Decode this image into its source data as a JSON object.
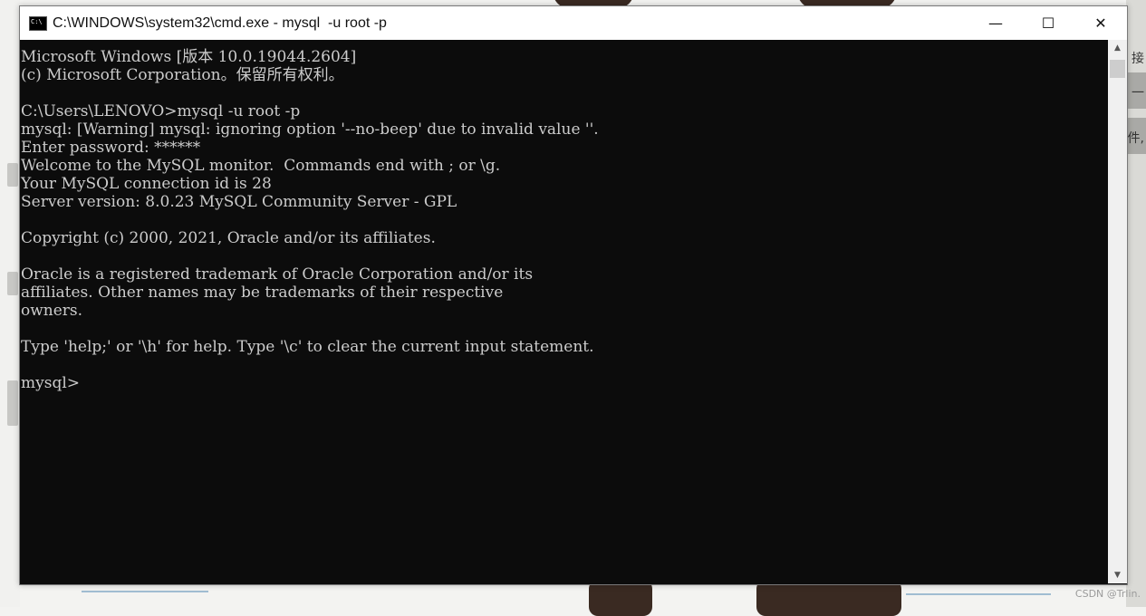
{
  "window": {
    "title": "C:\\WINDOWS\\system32\\cmd.exe - mysql  -u root -p",
    "controls": {
      "minimize": "—",
      "maximize": "☐",
      "close": "✕"
    }
  },
  "console": {
    "text": "Microsoft Windows [版本 10.0.19044.2604]\n(c) Microsoft Corporation。保留所有权利。\n\nC:\\Users\\LENOVO>mysql -u root -p\nmysql: [Warning] mysql: ignoring option '--no-beep' due to invalid value ''.\nEnter password: ******\nWelcome to the MySQL monitor.  Commands end with ; or \\g.\nYour MySQL connection id is 28\nServer version: 8.0.23 MySQL Community Server - GPL\n\nCopyright (c) 2000, 2021, Oracle and/or its affiliates.\n\nOracle is a registered trademark of Oracle Corporation and/or its\naffiliates. Other names may be trademarks of their respective\nowners.\n\nType 'help;' or '\\h' for help. Type '\\c' to clear the current input statement.\n\nmysql>"
  },
  "scrollbar": {
    "up": "▲",
    "down": "▼"
  },
  "background": {
    "side_chars": [
      "接",
      "一",
      "件,"
    ],
    "watermark": "CSDN @Trlin."
  }
}
